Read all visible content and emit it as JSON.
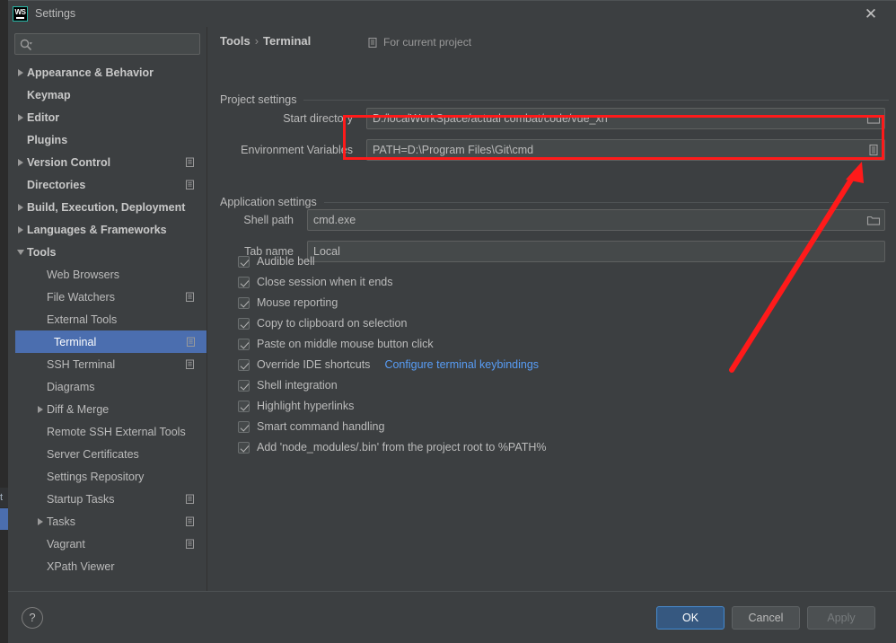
{
  "window": {
    "title": "Settings",
    "logo_text": "WS",
    "close_label": "✕"
  },
  "sidebar": {
    "search": {
      "value": "",
      "placeholder": ""
    },
    "items": [
      {
        "label": "Appearance & Behavior",
        "arrow": "right",
        "indent": 0,
        "bold": true,
        "scope": false,
        "selected": false
      },
      {
        "label": "Keymap",
        "arrow": "none",
        "indent": 0,
        "bold": true,
        "scope": false,
        "selected": false
      },
      {
        "label": "Editor",
        "arrow": "right",
        "indent": 0,
        "bold": true,
        "scope": false,
        "selected": false
      },
      {
        "label": "Plugins",
        "arrow": "none",
        "indent": 0,
        "bold": true,
        "scope": false,
        "selected": false
      },
      {
        "label": "Version Control",
        "arrow": "right",
        "indent": 0,
        "bold": true,
        "scope": true,
        "selected": false
      },
      {
        "label": "Directories",
        "arrow": "none",
        "indent": 0,
        "bold": true,
        "scope": true,
        "selected": false
      },
      {
        "label": "Build, Execution, Deployment",
        "arrow": "right",
        "indent": 0,
        "bold": true,
        "scope": false,
        "selected": false
      },
      {
        "label": "Languages & Frameworks",
        "arrow": "right",
        "indent": 0,
        "bold": true,
        "scope": false,
        "selected": false
      },
      {
        "label": "Tools",
        "arrow": "down",
        "indent": 0,
        "bold": true,
        "scope": false,
        "selected": false
      },
      {
        "label": "Web Browsers",
        "arrow": "none",
        "indent": 1,
        "bold": false,
        "scope": false,
        "selected": false
      },
      {
        "label": "File Watchers",
        "arrow": "none",
        "indent": 1,
        "bold": false,
        "scope": true,
        "selected": false
      },
      {
        "label": "External Tools",
        "arrow": "none",
        "indent": 1,
        "bold": false,
        "scope": false,
        "selected": false
      },
      {
        "label": "Terminal",
        "arrow": "none",
        "indent": 1,
        "bold": false,
        "scope": true,
        "selected": true
      },
      {
        "label": "SSH Terminal",
        "arrow": "none",
        "indent": 1,
        "bold": false,
        "scope": true,
        "selected": false
      },
      {
        "label": "Diagrams",
        "arrow": "none",
        "indent": 1,
        "bold": false,
        "scope": false,
        "selected": false
      },
      {
        "label": "Diff & Merge",
        "arrow": "right",
        "indent": 1,
        "bold": false,
        "scope": false,
        "selected": false
      },
      {
        "label": "Remote SSH External Tools",
        "arrow": "none",
        "indent": 1,
        "bold": false,
        "scope": false,
        "selected": false
      },
      {
        "label": "Server Certificates",
        "arrow": "none",
        "indent": 1,
        "bold": false,
        "scope": false,
        "selected": false
      },
      {
        "label": "Settings Repository",
        "arrow": "none",
        "indent": 1,
        "bold": false,
        "scope": false,
        "selected": false
      },
      {
        "label": "Startup Tasks",
        "arrow": "none",
        "indent": 1,
        "bold": false,
        "scope": true,
        "selected": false
      },
      {
        "label": "Tasks",
        "arrow": "right",
        "indent": 1,
        "bold": false,
        "scope": true,
        "selected": false
      },
      {
        "label": "Vagrant",
        "arrow": "none",
        "indent": 1,
        "bold": false,
        "scope": true,
        "selected": false
      },
      {
        "label": "XPath Viewer",
        "arrow": "none",
        "indent": 1,
        "bold": false,
        "scope": false,
        "selected": false
      }
    ]
  },
  "main": {
    "breadcrumb_root": "Tools",
    "breadcrumb_sep": "›",
    "breadcrumb_leaf": "Terminal",
    "for_current_project": "For current project",
    "project_settings_title": "Project settings",
    "application_settings_title": "Application settings",
    "fields": {
      "start_directory_label": "Start directory",
      "start_directory_value": "D:/localWorkSpace/actual combat/code/vue_xn",
      "environment_variables_label": "Environment Variables",
      "environment_variables_value": "PATH=D:\\Program Files\\Git\\cmd",
      "shell_path_label": "Shell path",
      "shell_path_value": "cmd.exe",
      "tab_name_label": "Tab name",
      "tab_name_value": "Local"
    },
    "checkboxes": [
      {
        "label": "Audible bell",
        "checked": true
      },
      {
        "label": "Close session when it ends",
        "checked": true
      },
      {
        "label": "Mouse reporting",
        "checked": true
      },
      {
        "label": "Copy to clipboard on selection",
        "checked": true
      },
      {
        "label": "Paste on middle mouse button click",
        "checked": true
      },
      {
        "label": "Override IDE shortcuts",
        "checked": true,
        "link": "Configure terminal keybindings"
      },
      {
        "label": "Shell integration",
        "checked": true
      },
      {
        "label": "Highlight hyperlinks",
        "checked": true
      },
      {
        "label": "Smart command handling",
        "checked": true
      },
      {
        "label": "Add 'node_modules/.bin' from the project root to %PATH%",
        "checked": true
      }
    ]
  },
  "footer": {
    "help_label": "?",
    "ok_label": "OK",
    "cancel_label": "Cancel",
    "apply_label": "Apply"
  },
  "annotation": {
    "color": "#ff1a1a"
  },
  "behind": {
    "tab_fragment": "t"
  }
}
